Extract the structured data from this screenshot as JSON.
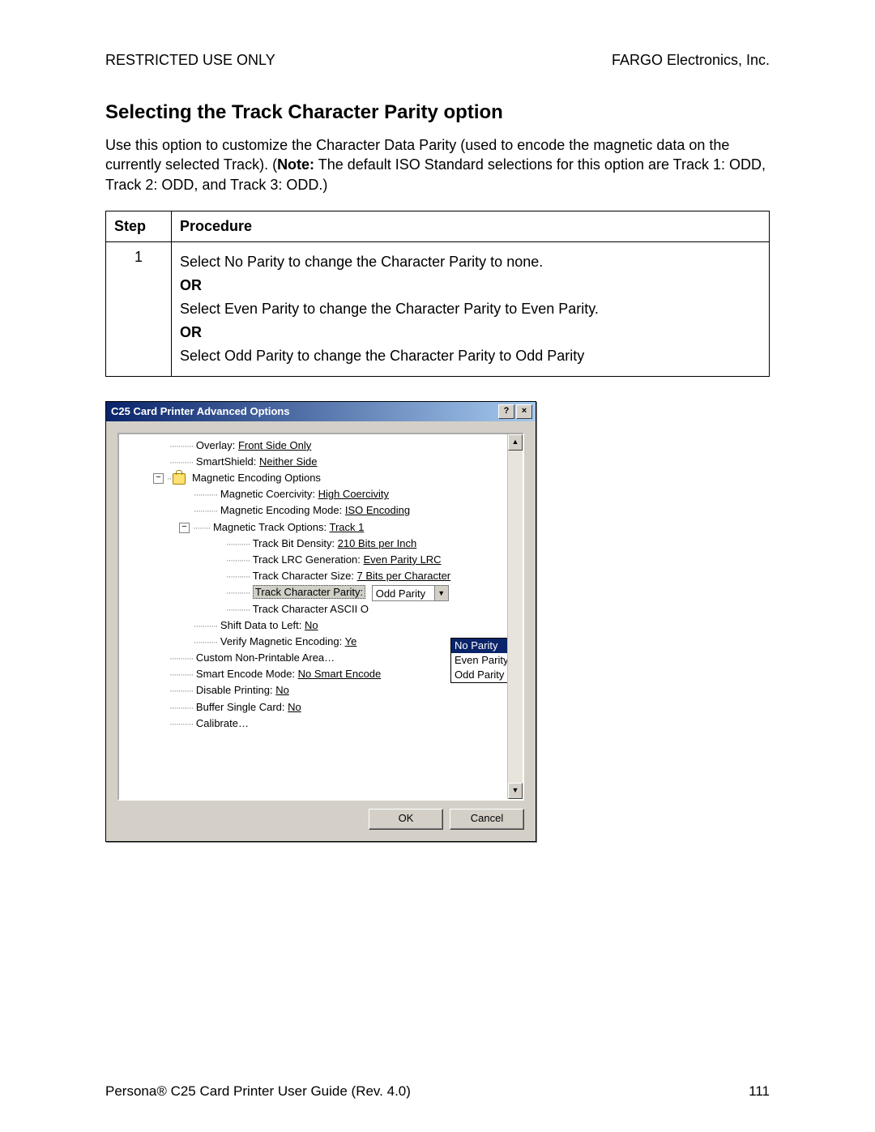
{
  "header": {
    "left": "RESTRICTED USE ONLY",
    "right": "FARGO Electronics, Inc."
  },
  "title": "Selecting the Track Character Parity option",
  "intro_prefix": "Use this option to customize the Character Data Parity (used to encode the magnetic data on the currently selected Track).  (",
  "intro_note_label": "Note:",
  "intro_suffix": "  The default ISO Standard selections for this option are Track 1: ODD, Track 2: ODD, and Track 3: ODD.)",
  "table": {
    "head_step": "Step",
    "head_proc": "Procedure",
    "step_no": "1",
    "line1": "Select No Parity to change the Character Parity to none.",
    "or": "OR",
    "line2": "Select Even Parity to change the Character Parity to Even Parity.",
    "line3": "Select Odd Parity to change the Character Parity to Odd Parity"
  },
  "dialog": {
    "title": "C25 Card Printer Advanced Options",
    "help_btn": "?",
    "close_btn": "×",
    "scroll_up": "▲",
    "scroll_down": "▼",
    "combo_arrow": "▼",
    "minus": "−",
    "tree": {
      "overlay_label": "Overlay: ",
      "overlay_value": "Front Side Only",
      "smartshield_label": "SmartShield: ",
      "smartshield_value": "Neither Side",
      "mag_encoding_options": "Magnetic Encoding Options",
      "mag_coercivity_label": "Magnetic Coercivity: ",
      "mag_coercivity_value": "High Coercivity",
      "mag_mode_label": "Magnetic Encoding Mode: ",
      "mag_mode_value": "ISO Encoding",
      "mag_track_label": "Magnetic Track Options: ",
      "mag_track_value": "Track 1",
      "bit_density_label": "Track Bit Density: ",
      "bit_density_value": "210 Bits per Inch",
      "lrc_label": "Track LRC Generation: ",
      "lrc_value": "Even Parity LRC",
      "char_size_label": "Track Character Size: ",
      "char_size_value": "7 Bits per Character",
      "char_parity_label": "Track Character Parity:",
      "char_parity_value": "Odd Parity",
      "ascii_label": "Track Character ASCII O",
      "shift_label": "Shift Data to Left: ",
      "shift_value": "No",
      "verify_label": "Verify Magnetic Encoding: ",
      "verify_value": "Ye",
      "custom_area": "Custom Non-Printable Area…",
      "smart_encode_label": "Smart Encode Mode: ",
      "smart_encode_value": "No Smart Encode",
      "disable_print_label": "Disable Printing: ",
      "disable_print_value": "No",
      "buffer_label": "Buffer Single Card: ",
      "buffer_value": "No",
      "calibrate": "Calibrate…"
    },
    "dropdown": {
      "opt1": "No Parity",
      "opt2": "Even Parity",
      "opt3": "Odd Parity"
    },
    "ok": "OK",
    "cancel": "Cancel"
  },
  "footer": {
    "left": "Persona® C25 Card Printer User Guide (Rev. 4.0)",
    "right": "111"
  }
}
